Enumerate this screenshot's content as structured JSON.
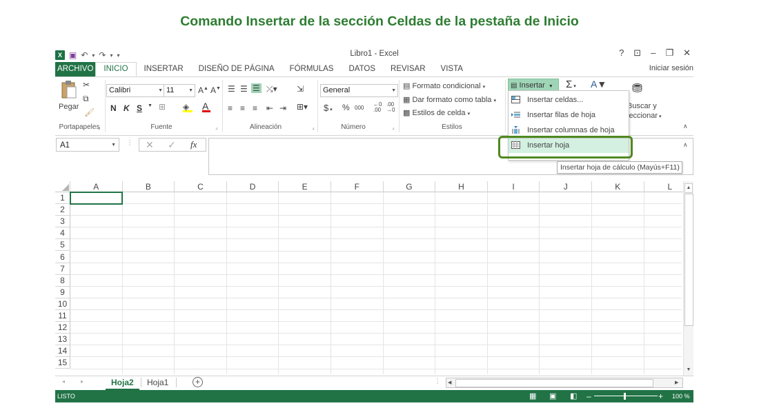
{
  "headline": "Comando Insertar de la sección Celdas de la pestaña de Inicio",
  "window": {
    "title": "Libro1 - Excel",
    "app_icon": "X",
    "help": "?",
    "restore_ribbon": "⌧",
    "minimize": "–",
    "maximize": "❐",
    "close": "✕",
    "signin": "Iniciar sesión"
  },
  "qat": {
    "save": "💾",
    "undo": "↶",
    "redo": "↷",
    "custom": "▾"
  },
  "tabs": [
    "ARCHIVO",
    "INICIO",
    "INSERTAR",
    "DISEÑO DE PÁGINA",
    "FÓRMULAS",
    "DATOS",
    "REVISAR",
    "VISTA"
  ],
  "ribbon": {
    "clipboard": {
      "paste": "Pegar",
      "label": "Portapapeles"
    },
    "font": {
      "name": "Calibri",
      "size": "11",
      "bold": "N",
      "italic": "K",
      "underline": "S",
      "label": "Fuente"
    },
    "alignment": {
      "label": "Alineación"
    },
    "number": {
      "format": "General",
      "currency": "$",
      "percent": "%",
      "thousands": "000",
      "label": "Número"
    },
    "styles": {
      "conditional": "Formato condicional",
      "table": "Dar formato como tabla",
      "cell_styles": "Estilos de celda",
      "label": "Estilos"
    },
    "cells": {
      "insert": "Insertar"
    },
    "editing": {
      "sigma": "Σ",
      "find": "Buscar y",
      "select": "leccionar"
    }
  },
  "insert_menu": {
    "items": [
      "Insertar celdas...",
      "Insertar filas de hoja",
      "Insertar columnas de hoja",
      "Insertar hoja"
    ],
    "tooltip": "Insertar hoja de cálculo (Mayús+F11)"
  },
  "formula_bar": {
    "name_box": "A1",
    "cancel": "✕",
    "enter": "✓",
    "fx": "fx"
  },
  "columns": [
    "A",
    "B",
    "C",
    "D",
    "E",
    "F",
    "G",
    "H",
    "I",
    "J",
    "K",
    "L"
  ],
  "rows": [
    "1",
    "2",
    "3",
    "4",
    "5",
    "6",
    "7",
    "8",
    "9",
    "10",
    "11",
    "12",
    "13",
    "14",
    "15"
  ],
  "sheets": {
    "tabs": [
      "Hoja2",
      "Hoja1"
    ],
    "active": "Hoja2",
    "add": "+"
  },
  "status": {
    "mode": "LISTO",
    "zoom": "100 %",
    "minus": "–",
    "plus": "+"
  },
  "colors": {
    "excel_green": "#217346",
    "highlight": "#4e8a1f",
    "headline": "#2e7d32",
    "menu_hover": "#d3f0e0"
  }
}
